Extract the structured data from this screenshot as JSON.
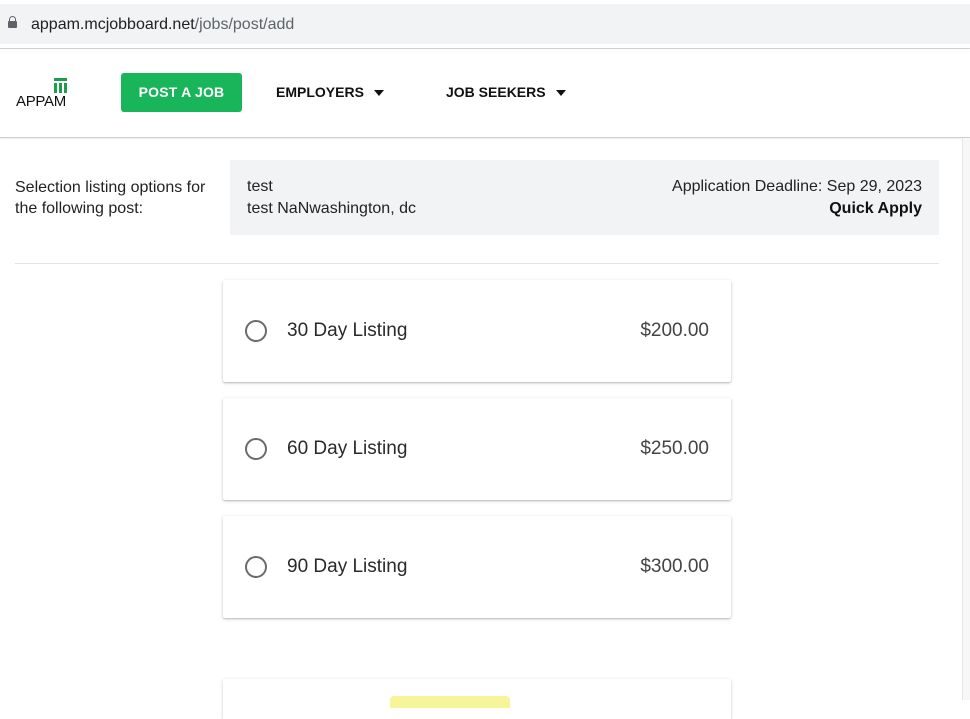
{
  "browser": {
    "url_host": "appam.mcjobboard.net",
    "url_path": "/jobs/post/add"
  },
  "header": {
    "logo_text": "APPAM",
    "post_job_label": "POST A JOB",
    "nav": [
      {
        "label": "EMPLOYERS"
      },
      {
        "label": "JOB SEEKERS"
      }
    ],
    "brand_color": "#19b55a"
  },
  "selection": {
    "label": "Selection listing options for the following post:",
    "post_title": "test",
    "post_location": "test NaNwashington, dc",
    "deadline": "Application Deadline: Sep 29, 2023",
    "apply_type": "Quick Apply"
  },
  "listings": [
    {
      "name": "30 Day Listing",
      "price": "$200.00",
      "selected": false
    },
    {
      "name": "60 Day Listing",
      "price": "$250.00",
      "selected": false
    },
    {
      "name": "90 Day Listing",
      "price": "$300.00",
      "selected": false
    }
  ]
}
